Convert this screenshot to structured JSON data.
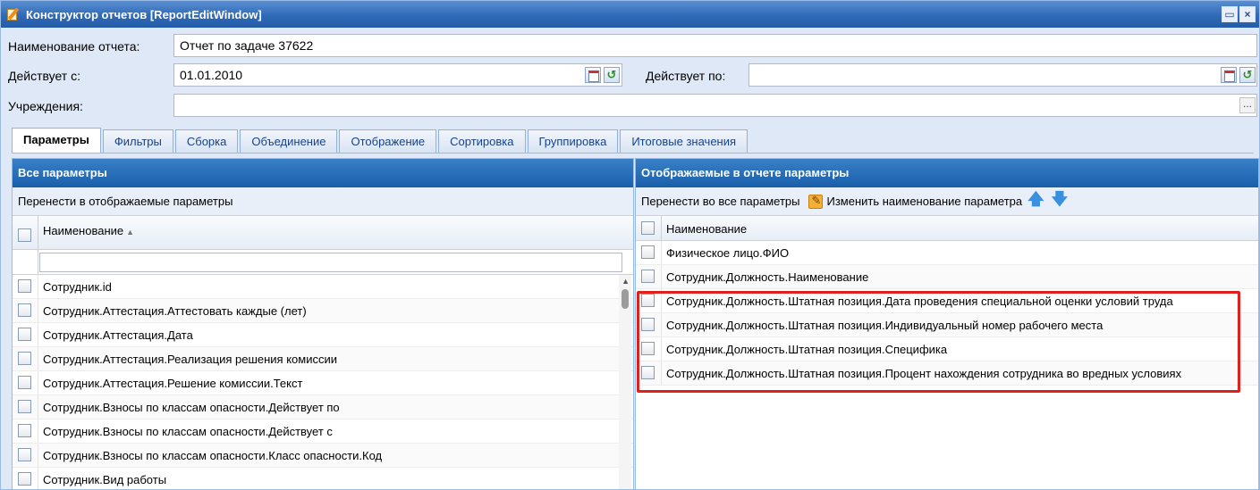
{
  "window": {
    "title": "Конструктор отчетов [ReportEditWindow]",
    "maximize_symbol": "▭",
    "close_symbol": "×"
  },
  "form": {
    "name_label": "Наименование отчета:",
    "name_value": "Отчет по задаче 37622",
    "valid_from_label": "Действует с:",
    "valid_from_value": "01.01.2010",
    "valid_to_label": "Действует по:",
    "valid_to_value": "",
    "institutions_label": "Учреждения:",
    "institutions_value": "",
    "dots_label": "..."
  },
  "tabs": [
    {
      "label": "Параметры",
      "active": true
    },
    {
      "label": "Фильтры"
    },
    {
      "label": "Сборка"
    },
    {
      "label": "Объединение"
    },
    {
      "label": "Отображение"
    },
    {
      "label": "Сортировка"
    },
    {
      "label": "Группировка"
    },
    {
      "label": "Итоговые значения"
    }
  ],
  "left_panel": {
    "title": "Все параметры",
    "toolbar_move": "Перенести в отображаемые параметры",
    "column_header": "Наименование",
    "sort_indicator": "▲",
    "scroll_up": "▲",
    "rows": [
      "Сотрудник.id",
      "Сотрудник.Аттестация.Аттестовать каждые (лет)",
      "Сотрудник.Аттестация.Дата",
      "Сотрудник.Аттестация.Реализация решения комиссии",
      "Сотрудник.Аттестация.Решение комиссии.Текст",
      "Сотрудник.Взносы по классам опасности.Действует по",
      "Сотрудник.Взносы по классам опасности.Действует с",
      "Сотрудник.Взносы по классам опасности.Класс опасности.Код",
      "Сотрудник.Вид работы"
    ]
  },
  "right_panel": {
    "title": "Отображаемые в отчете параметры",
    "toolbar_move": "Перенести во все параметры",
    "toolbar_rename": "Изменить наименование параметра",
    "arrow_up": "🡅",
    "arrow_down": "🡇",
    "column_header": "Наименование",
    "rows": [
      "Физическое лицо.ФИО",
      "Сотрудник.Должность.Наименование",
      "Сотрудник.Должность.Штатная позиция.Дата проведения специальной оценки условий труда",
      "Сотрудник.Должность.Штатная позиция.Индивидуальный номер рабочего места",
      "Сотрудник.Должность.Штатная позиция.Специфика",
      "Сотрудник.Должность.Штатная позиция.Процент нахождения сотрудника во вредных условиях"
    ]
  },
  "colors": {
    "highlight": "#e2201b",
    "header_blue": "#185ea9"
  }
}
